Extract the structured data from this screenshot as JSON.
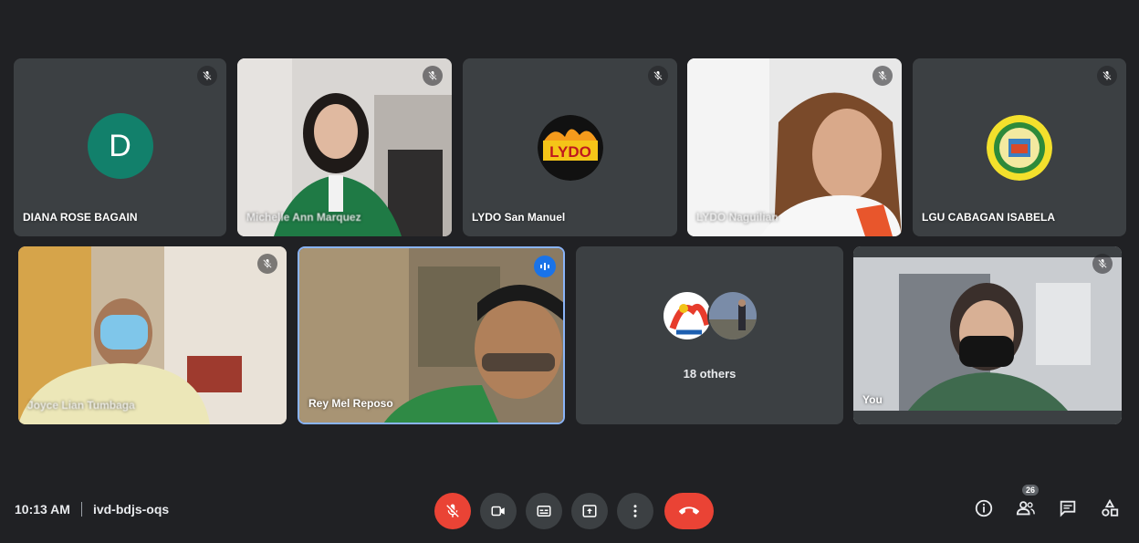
{
  "tiles": [
    {
      "name": "DIANA ROSE BAGAIN",
      "avatar_letter": "D",
      "muted": true
    },
    {
      "name": "Michelle Ann Marquez",
      "muted": true
    },
    {
      "name": "LYDO San Manuel",
      "logo_text": "LYDO",
      "muted": true
    },
    {
      "name": "LYDO Naguilian",
      "muted": true
    },
    {
      "name": "LGU CABAGAN ISABELA",
      "muted": true
    },
    {
      "name": "Joyce Lian Tumbaga",
      "muted": true
    },
    {
      "name": "Rey Mel Reposo",
      "speaking": true
    },
    {
      "others_label": "18 others"
    },
    {
      "name": "You",
      "muted": true
    }
  ],
  "bottom": {
    "time": "10:13 AM",
    "meeting_code": "ivd-bdjs-oqs",
    "participant_count": "26"
  },
  "controls": [
    {
      "name": "microphone-off",
      "icon": "mic-off-icon"
    },
    {
      "name": "camera",
      "icon": "camera-icon"
    },
    {
      "name": "captions",
      "icon": "captions-icon"
    },
    {
      "name": "present",
      "icon": "present-icon"
    },
    {
      "name": "more-options",
      "icon": "more-vert-icon"
    },
    {
      "name": "leave-call",
      "icon": "call-end-icon"
    }
  ],
  "colors": {
    "background": "#202124",
    "tile": "#3c4043",
    "red": "#ea4335",
    "blue": "#1a73e8",
    "avatar_green": "#12806b"
  }
}
